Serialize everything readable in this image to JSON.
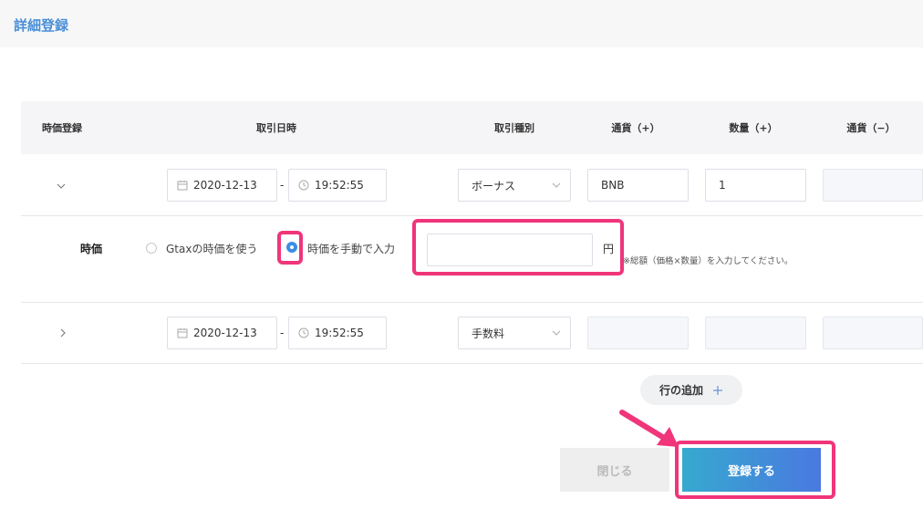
{
  "page": {
    "title": "詳細登録"
  },
  "table": {
    "headers": [
      "時価登録",
      "取引日時",
      "取引種別",
      "通貨（+）",
      "数量（+）",
      "通貨（−）"
    ],
    "rows": [
      {
        "date": "2020-12-13",
        "dash": "-",
        "time": "19:52:55",
        "type": "ボーナス",
        "currency_plus": "BNB",
        "quantity_plus": "1",
        "currency_minus": ""
      },
      {
        "date": "2020-12-13",
        "dash": "-",
        "time": "19:52:55",
        "type": "手数料",
        "currency_plus": "",
        "quantity_plus": "",
        "currency_minus": ""
      }
    ]
  },
  "price_section": {
    "label": "時価",
    "option_gtax": "Gtaxの時価を使う",
    "option_manual": "時価を手動で入力",
    "selected": "option_manual",
    "input_value": "",
    "unit": "円",
    "hint": "※総額（価格×数量）を入力してください。"
  },
  "actions": {
    "add_row": "行の追加",
    "close": "閉じる",
    "submit": "登録する"
  },
  "colors": {
    "accent": "#3a8ee6",
    "highlight": "#f0357a",
    "title": "#4a8fd6"
  }
}
